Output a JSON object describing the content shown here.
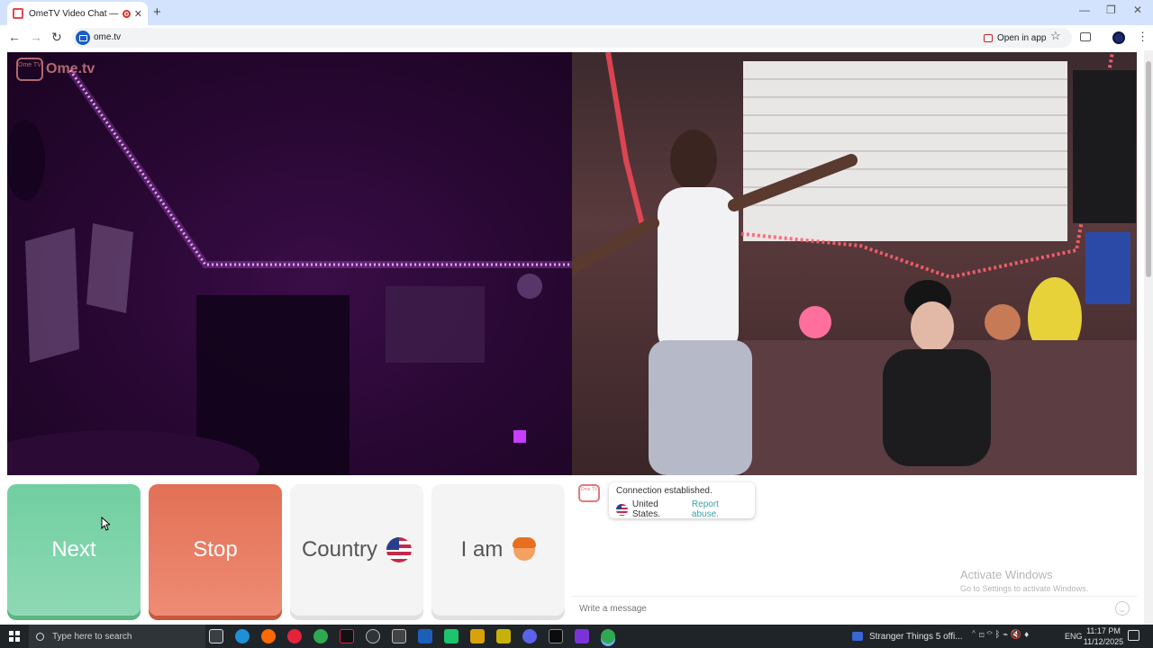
{
  "browser": {
    "tab_title": "OmeTV Video Chat — Ome",
    "url": "ome.tv",
    "open_in_app": "Open in app",
    "new_tab_symbol": "+",
    "tab_close_symbol": "✕",
    "back_symbol": "←",
    "forward_symbol": "→",
    "reload_symbol": "↻",
    "star_symbol": "☆",
    "menu_symbol": "⋮",
    "minimize_symbol": "—",
    "maximize_symbol": "❐",
    "close_symbol": "✕"
  },
  "logo": {
    "small": "Ome TV",
    "brand": "Ome.tv"
  },
  "controls": {
    "next": "Next",
    "stop": "Stop",
    "country": "Country",
    "i_am": "I am"
  },
  "chat": {
    "logo_small": "Ome TV",
    "connection": "Connection established.",
    "country": "United States.",
    "report": "Report abuse.",
    "placeholder": "Write a message"
  },
  "watermark": {
    "line1": "Activate Windows",
    "line2": "Go to Settings to activate Windows."
  },
  "taskbar": {
    "search_placeholder": "Type here to search",
    "running_task": "Stranger Things 5 offi...",
    "language": "ENG",
    "time": "11:17 PM",
    "date": "11/12/2025",
    "tray_icons": "⌃ ⊡ ⌔ ᛒ ⌁ 🔇 ♦"
  },
  "colors": {
    "next": "#71cfa0",
    "stop": "#e27055",
    "neutral": "#f4f4f4",
    "link": "#3aa0a8"
  }
}
